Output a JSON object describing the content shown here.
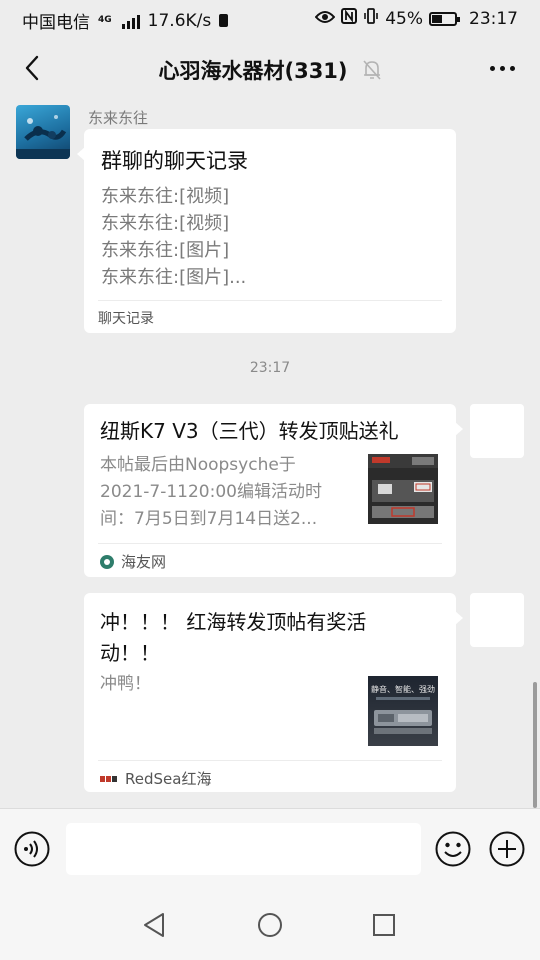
{
  "status_bar": {
    "carrier": "中国电信",
    "net_type": "4G",
    "speed": "17.6K/s",
    "battery": "45%",
    "battery_level": 0.45,
    "time": "23:17"
  },
  "header": {
    "title": "心羽海水器材(331)",
    "icons": [
      "back-icon",
      "mute-bell-icon",
      "more-icon"
    ]
  },
  "messages": [
    {
      "type": "chat_record",
      "direction": "incoming",
      "sender": "东来东往",
      "title": "群聊的聊天记录",
      "lines": [
        "东来东往:[视频]",
        "东来东往:[视频]",
        "东来东往:[图片]",
        "东来东往:[图片]..."
      ],
      "footer": "聊天记录"
    },
    {
      "type": "timestamp",
      "text": "23:17"
    },
    {
      "type": "link_card",
      "direction": "outgoing",
      "title": "纽斯K7 V3（三代）转发顶贴送礼",
      "desc_lines": [
        "本帖最后由Noopsyche于",
        "2021-7-1120:00编辑活动时",
        "间：7月5日到7月14日送2..."
      ],
      "source": "海友网"
    },
    {
      "type": "link_card",
      "direction": "outgoing",
      "title_lines": [
        "冲！！！ 红海转发顶帖有奖活",
        "动！！"
      ],
      "desc": "冲鸭！",
      "source": "RedSea红海",
      "thumb_text": "静音、智能、强劲"
    }
  ],
  "input_bar": {
    "placeholder": "",
    "icons": [
      "voice-icon",
      "emoji-icon",
      "plus-icon"
    ]
  },
  "system_nav": {
    "icons": [
      "nav-back-icon",
      "nav-home-icon",
      "nav-recents-icon"
    ]
  },
  "colors": {
    "background": "#ededed",
    "bubble": "#ffffff",
    "muted_text": "#8a8a8a",
    "input_bar": "#f6f6f6"
  }
}
